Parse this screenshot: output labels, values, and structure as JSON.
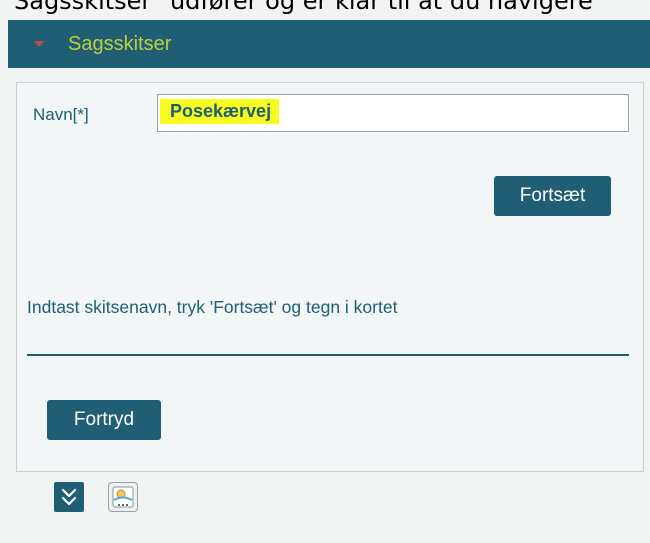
{
  "caption": "Sagsskitser\" udfører og er klar til at du navigere",
  "panel": {
    "title": "Sagsskitser",
    "collapse_icon": "triangle-down-icon",
    "accent_color": "#1f5e73",
    "title_color": "#bccf3d"
  },
  "form": {
    "name_label": "Navn[*]",
    "name_value": "Posekærvej",
    "continue_label": "Fortsæt",
    "instruction": "Indtast skitsenavn, tryk 'Fortsæt' og tegn i kortet",
    "cancel_label": "Fortryd"
  },
  "toolbar": {
    "expand_icon": "double-chevron-down-icon",
    "sketch_icon": "sketch-map-icon"
  }
}
